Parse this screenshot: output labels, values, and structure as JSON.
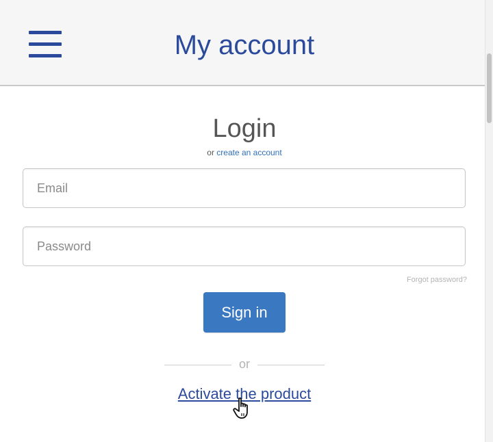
{
  "header": {
    "menu_icon": "hamburger-menu-icon",
    "title": "My account"
  },
  "login": {
    "title": "Login",
    "create_prefix": "or",
    "create_link": "create an account",
    "email_placeholder": "Email",
    "email_value": "",
    "password_placeholder": "Password",
    "password_value": "",
    "forgot_password": "Forgot password?",
    "signin_label": "Sign in",
    "or_label": "or",
    "activate_link": "Activate the product"
  },
  "cursor": {
    "icon": "hand-pointer-cursor-icon"
  },
  "colors": {
    "brand": "#2b4a9b",
    "button": "#3a78c2",
    "link": "#2f6fb8"
  }
}
